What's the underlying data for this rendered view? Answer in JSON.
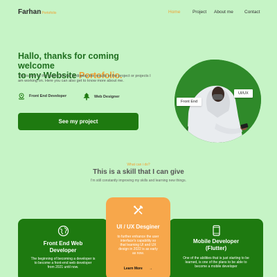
{
  "nav": {
    "logo": "Farhan",
    "logo_sub": "Portofolio",
    "items": [
      "Home",
      "Project",
      "About me",
      "Contact"
    ]
  },
  "hero": {
    "title_line1": "Hallo, thanks for coming welcome",
    "title_line2": "to my Website ",
    "title_accent": "Portofolio.",
    "description": "This is one of the places for me to display the results of the project or projects I am working on. Here you can also get to know more about me.",
    "roles": [
      "Front End Developer",
      "Web Designer"
    ],
    "cta_label": "See my project",
    "photo_tags": [
      "Front End",
      "UI/UX"
    ]
  },
  "skills": {
    "kicker": "What can i do?",
    "title": "This is a skill that I can give",
    "subtitle": "I'm still constantly improving my skills and learning new things.",
    "cards": [
      {
        "title_line1": "Front End Web",
        "title_line2": "Developer",
        "body": "The beginning of becoming a developer is to become a front-end web developer from 2021 until now."
      },
      {
        "title": "UI / UX Desginer",
        "body": "to further enhance the user interface's capability so that learning UI and UX design in 2022 is as early as now.",
        "link_label": "Learn More",
        "link_arrow": "→"
      },
      {
        "title_line1": "Mobile Developer",
        "title_line2": "(Flutter)",
        "body": "One of the abilities that is just starting to be learned, is one of the plans to be able to become a mobile developer"
      }
    ]
  },
  "colors": {
    "background": "#c6f4c6",
    "primary_green": "#1e7a10",
    "accent_orange": "#f0a030",
    "card_orange": "#f7a74b"
  }
}
